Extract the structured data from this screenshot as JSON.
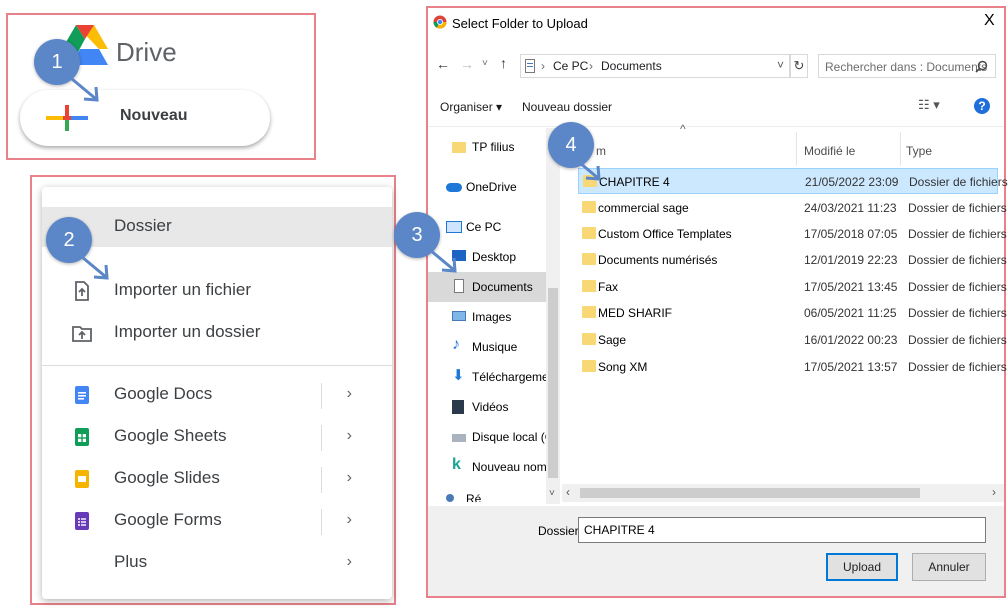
{
  "panel1": {
    "drive_title": "Drive",
    "new_button": "Nouveau",
    "step": "1"
  },
  "panel2": {
    "step": "2",
    "items": [
      {
        "label": "Dossier"
      },
      {
        "label": "Importer un fichier"
      },
      {
        "label": "Importer un dossier"
      },
      {
        "label": "Google Docs",
        "chevron": "›"
      },
      {
        "label": "Google Sheets",
        "chevron": "›"
      },
      {
        "label": "Google Slides",
        "chevron": "›"
      },
      {
        "label": "Google Forms",
        "chevron": "›"
      },
      {
        "label": "Plus",
        "chevron": "›"
      }
    ]
  },
  "dialog": {
    "title": "Select Folder to Upload",
    "close": "X",
    "path": [
      "Ce PC",
      "Documents"
    ],
    "path_sep": "›",
    "search_placeholder": "Rechercher dans : Documents",
    "organize": "Organiser ▾",
    "new_folder": "Nouveau dossier",
    "help": "?",
    "step3": "3",
    "step4": "4",
    "nav": [
      "TP filius",
      "OneDrive",
      "Ce PC",
      "Desktop",
      "Documents",
      "Images",
      "Musique",
      "Téléchargement",
      "Vidéos",
      "Disque local (C:)",
      "Nouveau nom (I",
      "Ré"
    ],
    "columns": {
      "name": "m",
      "modified": "Modifié le",
      "type": "Type"
    },
    "rows": [
      {
        "name": "CHAPITRE 4",
        "date": "21/05/2022 23:09",
        "type": "Dossier de fichiers"
      },
      {
        "name": "commercial sage",
        "date": "24/03/2021 11:23",
        "type": "Dossier de fichiers"
      },
      {
        "name": "Custom Office Templates",
        "date": "17/05/2018 07:05",
        "type": "Dossier de fichiers"
      },
      {
        "name": "Documents numérisés",
        "date": "12/01/2019 22:23",
        "type": "Dossier de fichiers"
      },
      {
        "name": "Fax",
        "date": "17/05/2021 13:45",
        "type": "Dossier de fichiers"
      },
      {
        "name": "MED SHARIF",
        "date": "06/05/2021 11:25",
        "type": "Dossier de fichiers"
      },
      {
        "name": "Sage",
        "date": "16/01/2022 00:23",
        "type": "Dossier de fichiers"
      },
      {
        "name": "Song XM",
        "date": "17/05/2021 13:57",
        "type": "Dossier de fichiers"
      }
    ],
    "folder_label": "Dossier :",
    "folder_value": "CHAPITRE 4",
    "upload": "Upload",
    "cancel": "Annuler"
  }
}
